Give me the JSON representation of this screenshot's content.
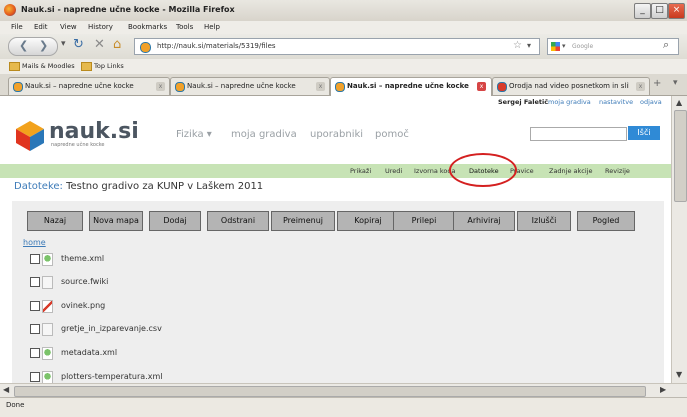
{
  "window": {
    "title": "Nauk.si - napredne učne kocke - Mozilla Firefox"
  },
  "menu": [
    "File",
    "Edit",
    "View",
    "History",
    "Bookmarks",
    "Tools",
    "Help"
  ],
  "nav": {
    "url": "http://nauk.si/materials/5319/files",
    "search_placeholder": "Google"
  },
  "bookmarks": [
    "Mails & Moodles",
    "Top Links"
  ],
  "tabs": [
    {
      "label": "Nauk.si – napredne učne kocke",
      "active": false
    },
    {
      "label": "Nauk.si – napredne učne kocke",
      "active": false
    },
    {
      "label": "Nauk.si – napredne učne kocke",
      "active": true
    },
    {
      "label": "Orodja nad video posnetkom in sliko...",
      "active": false
    }
  ],
  "user": {
    "name": "Sergej Faletič",
    "links": [
      "moja gradiva",
      "nastavitve",
      "odjava"
    ]
  },
  "logo": {
    "name": "nauk.si",
    "tagline": "napredne učne kocke"
  },
  "main_nav": [
    "Fizika ▾",
    "moja gradiva",
    "uporabniki",
    "pomoč"
  ],
  "search_button": "Išči",
  "sub_nav": [
    "Prikaži",
    "Uredi",
    "Izvorna koda",
    "Datoteke",
    "Pravice",
    "Zadnje akcije",
    "Revizije"
  ],
  "page": {
    "heading_prefix": "Datoteke:",
    "heading": "Testno gradivo za KUNP v Laškem 2011"
  },
  "toolbar": [
    "Nazaj",
    "Nova mapa",
    "Dodaj",
    "Odstrani",
    "Preimenuj",
    "Kopiraj",
    "Prilepi",
    "Arhiviraj",
    "Izlušči",
    "Pogled"
  ],
  "home_link": "home",
  "files": [
    {
      "name": "theme.xml",
      "icon": "green-xml-icon"
    },
    {
      "name": "source.fwiki",
      "icon": "blank-file-icon"
    },
    {
      "name": "ovinek.png",
      "icon": "image-file-icon"
    },
    {
      "name": "gretje_in_izparevanje.csv",
      "icon": "blank-file-icon"
    },
    {
      "name": "metadata.xml",
      "icon": "green-xml-icon"
    },
    {
      "name": "plotters-temperatura.xml",
      "icon": "green-xml-icon"
    }
  ],
  "status": "Done"
}
